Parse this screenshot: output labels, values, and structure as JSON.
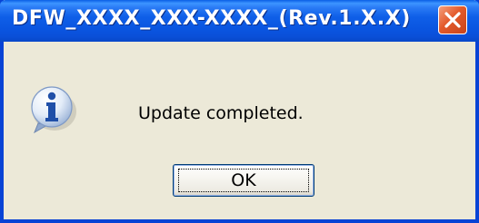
{
  "dialog": {
    "title": "DFW_XXXX_XXX-XXXX_(Rev.1.X.X)",
    "message": "Update completed.",
    "ok_label": "OK",
    "icon": "info-icon",
    "close_icon": "close-icon"
  },
  "colors": {
    "titlebar_blue": "#0A55E0",
    "close_red": "#E35A2B",
    "dialog_background": "#ECE9D8"
  }
}
